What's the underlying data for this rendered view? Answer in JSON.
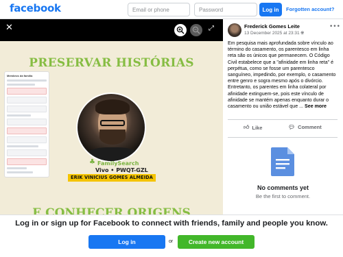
{
  "header": {
    "logo": "facebook",
    "email_placeholder": "Email or phone",
    "password_placeholder": "Password",
    "login_label": "Log in",
    "forgot_label": "Forgotten account?"
  },
  "viewer": {
    "close_icon": "close-icon",
    "zoom_in_icon": "zoom-in-icon",
    "zoom_out_icon": "zoom-out-icon",
    "expand_icon": "expand-icon",
    "image": {
      "headline_top": "PRESERVAR HISTÓRIAS",
      "phone_title": "Membros da família",
      "familysearch": "FamilySearch",
      "vivo": "Vivo • PWQT-GZL",
      "person_name": "ERIK VINICIUS GOMES ALMEIDA",
      "headline_bottom": "E CONHECER ORIGENS"
    }
  },
  "post": {
    "author": "Frederick Gomes Leite",
    "timestamp": "13 December 2025 at 23:31",
    "body": "Em pesquisa mais aprofundada sobre vínculo ao término do casamento, os parentesco em linha reta são os únicos que permanecem. O Código Civil estabelece que a \"afinidade em linha reta\" é perpétua, como se fosse um parentesco sanguíneo, impedindo, por exemplo, o casamento entre genro e sogra mesmo após o divórcio. Entretanto, os parentes em linha colateral por afinidade extinguem-se, pois este vínculo de afinidade se mantém apenas enquanto durar o casamento ou união estável que ...",
    "see_more": "See more",
    "like_label": "Like",
    "comment_label": "Comment",
    "no_comments": "No comments yet",
    "be_first": "Be the first to comment."
  },
  "footer": {
    "cta": "Log in or sign up for Facebook to connect with friends, family and people you know.",
    "login_label": "Log in",
    "or_label": "or",
    "create_label": "Create new account"
  },
  "colors": {
    "brand": "#1877f2",
    "create_green": "#42b72a",
    "headline_green": "#86bd43",
    "name_banner": "#f5c400"
  }
}
